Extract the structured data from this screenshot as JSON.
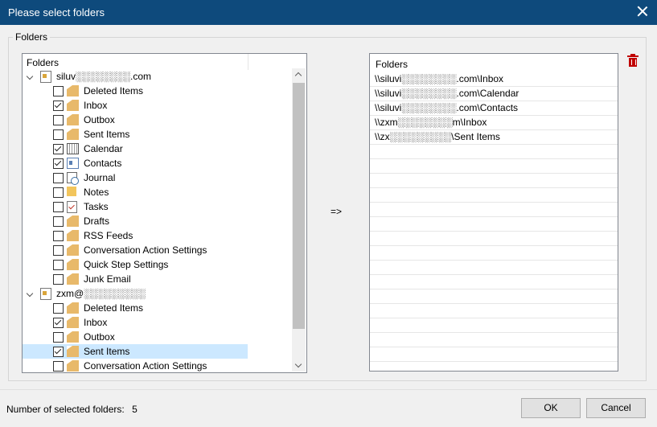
{
  "window": {
    "title": "Please select folders"
  },
  "group": {
    "label": "Folders"
  },
  "tree": {
    "header": "Folders",
    "accounts": [
      {
        "label": "siluv░░░░░░░░.com",
        "folders": [
          {
            "label": "Deleted Items",
            "checked": false,
            "icon": "folder-icon"
          },
          {
            "label": "Inbox",
            "checked": true,
            "icon": "folder-icon"
          },
          {
            "label": "Outbox",
            "checked": false,
            "icon": "folder-icon"
          },
          {
            "label": "Sent Items",
            "checked": false,
            "icon": "folder-icon"
          },
          {
            "label": "Calendar",
            "checked": true,
            "icon": "calendar-icon"
          },
          {
            "label": "Contacts",
            "checked": true,
            "icon": "contacts-icon"
          },
          {
            "label": "Journal",
            "checked": false,
            "icon": "journal-icon"
          },
          {
            "label": "Notes",
            "checked": false,
            "icon": "notes-icon"
          },
          {
            "label": "Tasks",
            "checked": false,
            "icon": "tasks-icon"
          },
          {
            "label": "Drafts",
            "checked": false,
            "icon": "folder-icon"
          },
          {
            "label": "RSS Feeds",
            "checked": false,
            "icon": "folder-icon"
          },
          {
            "label": "Conversation Action Settings",
            "checked": false,
            "icon": "folder-icon"
          },
          {
            "label": "Quick Step Settings",
            "checked": false,
            "icon": "folder-icon"
          },
          {
            "label": "Junk Email",
            "checked": false,
            "icon": "folder-icon"
          }
        ]
      },
      {
        "label": "zxm@░░░░░░░░░",
        "folders": [
          {
            "label": "Deleted Items",
            "checked": false,
            "icon": "folder-icon"
          },
          {
            "label": "Inbox",
            "checked": true,
            "icon": "folder-icon"
          },
          {
            "label": "Outbox",
            "checked": false,
            "icon": "folder-icon"
          },
          {
            "label": "Sent Items",
            "checked": true,
            "icon": "folder-icon",
            "selected": true
          },
          {
            "label": "Conversation Action Settings",
            "checked": false,
            "icon": "folder-icon"
          }
        ]
      }
    ]
  },
  "arrow": "=>",
  "selected_list": {
    "header": "Folders",
    "items": [
      "\\\\siluvi░░░░░░░░.com\\Inbox",
      "\\\\siluvi░░░░░░░░.com\\Calendar",
      "\\\\siluvi░░░░░░░░.com\\Contacts",
      "\\\\zxm░░░░░░░░m\\Inbox",
      "\\\\zx░░░░░░░░░\\Sent Items"
    ]
  },
  "footer": {
    "status_label": "Number of selected folders:",
    "status_count": "5",
    "ok_label": "OK",
    "cancel_label": "Cancel"
  },
  "colors": {
    "titlebar": "#0e4a7c",
    "accent_selected": "#cce8ff",
    "delete": "#c00000"
  }
}
